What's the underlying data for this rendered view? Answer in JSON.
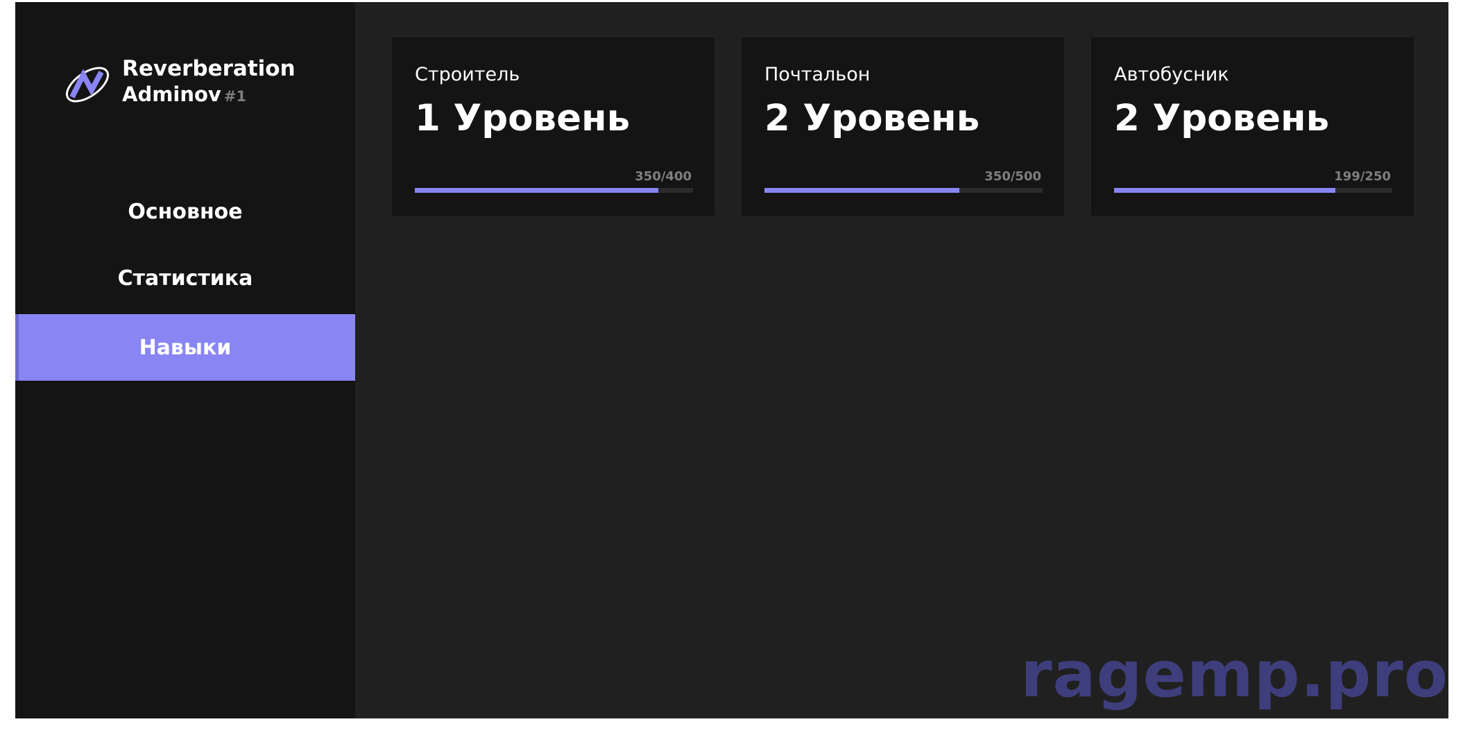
{
  "brand": {
    "name": "Reverberation",
    "user": "Adminov",
    "user_id": "#1",
    "logo_icon": "stylized-N-orbit-logo",
    "accent_color": "#8985f3"
  },
  "nav": {
    "items": [
      {
        "label": "Основное",
        "active": false
      },
      {
        "label": "Статистика",
        "active": false
      },
      {
        "label": "Навыки",
        "active": true
      }
    ]
  },
  "skills": [
    {
      "title": "Строитель",
      "level": "1 Уровень",
      "progress_text": "350/400",
      "progress": 0.875
    },
    {
      "title": "Почтальон",
      "level": "2 Уровень",
      "progress_text": "350/500",
      "progress": 0.7
    },
    {
      "title": "Автобусник",
      "level": "2 Уровень",
      "progress_text": "199/250",
      "progress": 0.796
    }
  ],
  "watermark": "ragemp.pro"
}
